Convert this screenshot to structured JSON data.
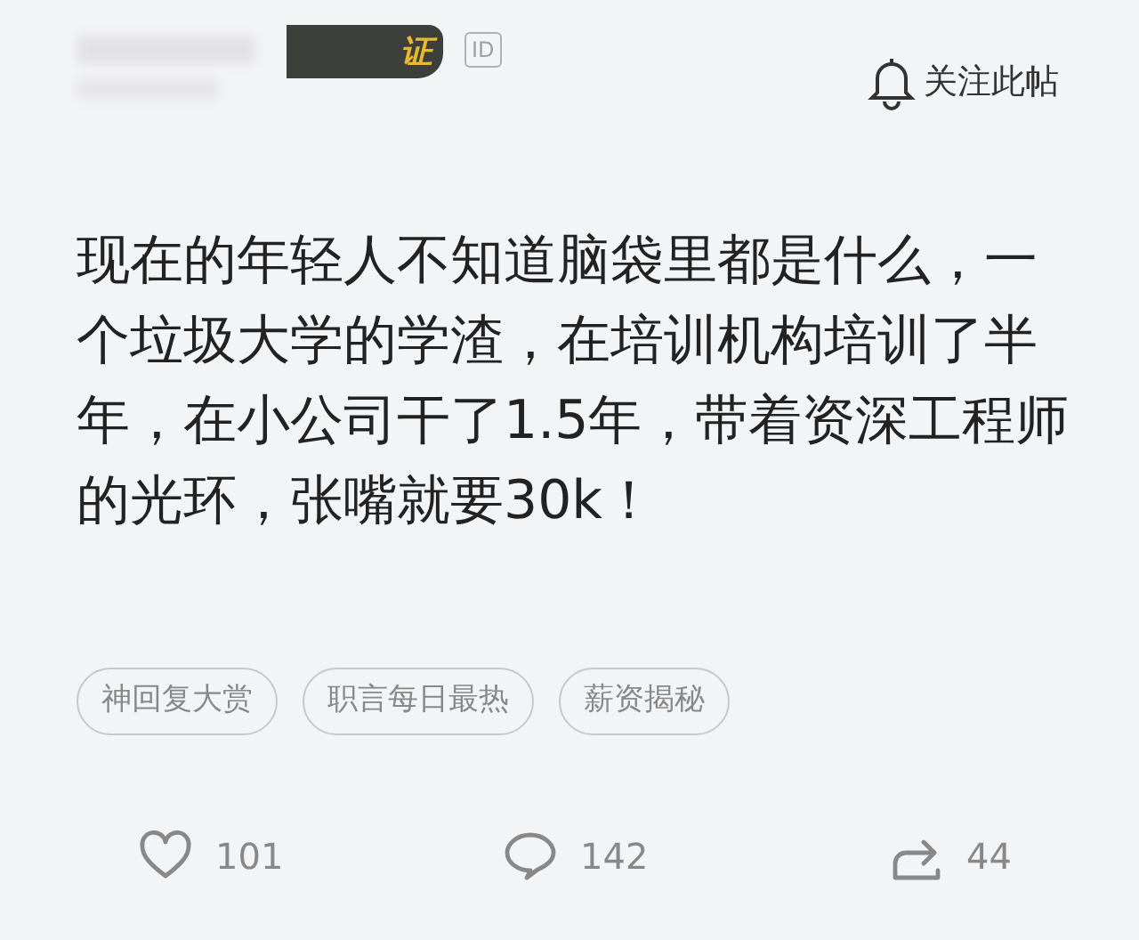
{
  "header": {
    "badge": "证",
    "id_tag": "ID",
    "follow": "关注此帖"
  },
  "body": "现在的年轻人不知道脑袋里都是什么，一个垃圾大学的学渣，在培训机构培训了半年，在小公司干了1.5年，带着资深工程师的光环，张嘴就要30k！",
  "tags": [
    "神回复大赏",
    "职言每日最热",
    "薪资揭秘"
  ],
  "actions": [
    {
      "kind": "like",
      "count": "101"
    },
    {
      "kind": "comment",
      "count": "142"
    },
    {
      "kind": "share",
      "count": "44"
    }
  ]
}
